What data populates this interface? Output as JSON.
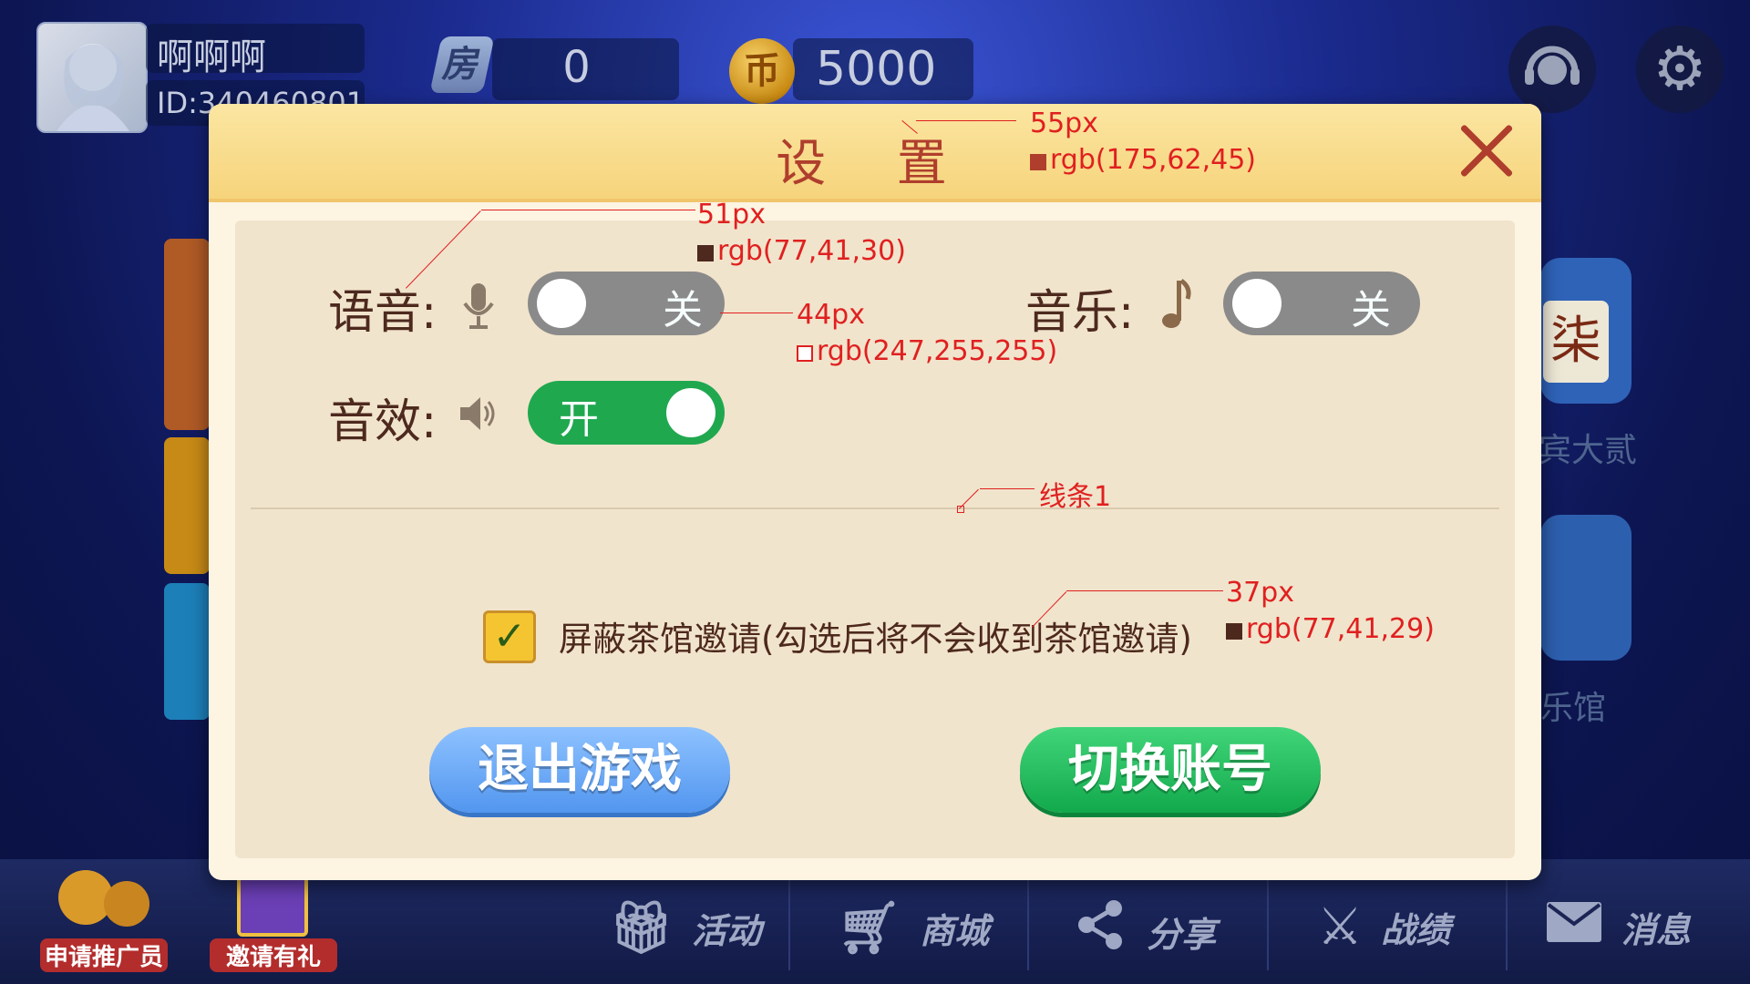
{
  "top_bar": {
    "player_name": "啊啊啊",
    "player_id": "ID:340460801",
    "room_icon_label": "房",
    "room_count": "0",
    "coin_icon_label": "币",
    "coin_count": "5000",
    "service_icon": "headset-icon",
    "settings_icon": "gear-icon"
  },
  "background_cards": {
    "right_tile_char": "柒",
    "right_card1_label": "宾大贰",
    "right_card2_label": "乐馆"
  },
  "dialog": {
    "title": "设 置",
    "close_icon": "close-icon",
    "voice_label": "语音:",
    "voice_icon": "microphone-icon",
    "voice_toggle_text": "关",
    "voice_on": false,
    "music_label": "音乐:",
    "music_icon": "music-note-icon",
    "music_toggle_text": "关",
    "music_on": false,
    "sfx_label": "音效:",
    "sfx_icon": "speaker-icon",
    "sfx_toggle_text": "开",
    "sfx_on": true,
    "block_invite_checked": true,
    "block_invite_text": "屏蔽茶馆邀请(勾选后将不会收到茶馆邀请)",
    "exit_button": "退出游戏",
    "switch_account_button": "切换账号"
  },
  "annotations": {
    "title_size": "55px",
    "title_color": "rgb(175,62,45)",
    "label_size": "51px",
    "label_color": "rgb(77,41,30)",
    "toggle_text_size": "44px",
    "toggle_text_color": "rgb(247,255,255)",
    "divider_name": "线条1",
    "check_text_size": "37px",
    "check_text_color": "rgb(77,41,29)"
  },
  "bottom_bar": {
    "promoter_label": "申请推广员",
    "invite_label": "邀请有礼",
    "items": [
      {
        "label": "活动",
        "icon": "gift-icon"
      },
      {
        "label": "商城",
        "icon": "cart-icon"
      },
      {
        "label": "分享",
        "icon": "share-icon"
      },
      {
        "label": "战绩",
        "icon": "crossed-swords-icon"
      },
      {
        "label": "消息",
        "icon": "mail-icon"
      }
    ]
  },
  "colors": {
    "title": "#af3e2d",
    "label": "#4d291e",
    "toggle_off": "#8a8a8a",
    "toggle_on": "#20a84f",
    "exit_button": "#5296ef",
    "switch_button": "#11a94b"
  }
}
